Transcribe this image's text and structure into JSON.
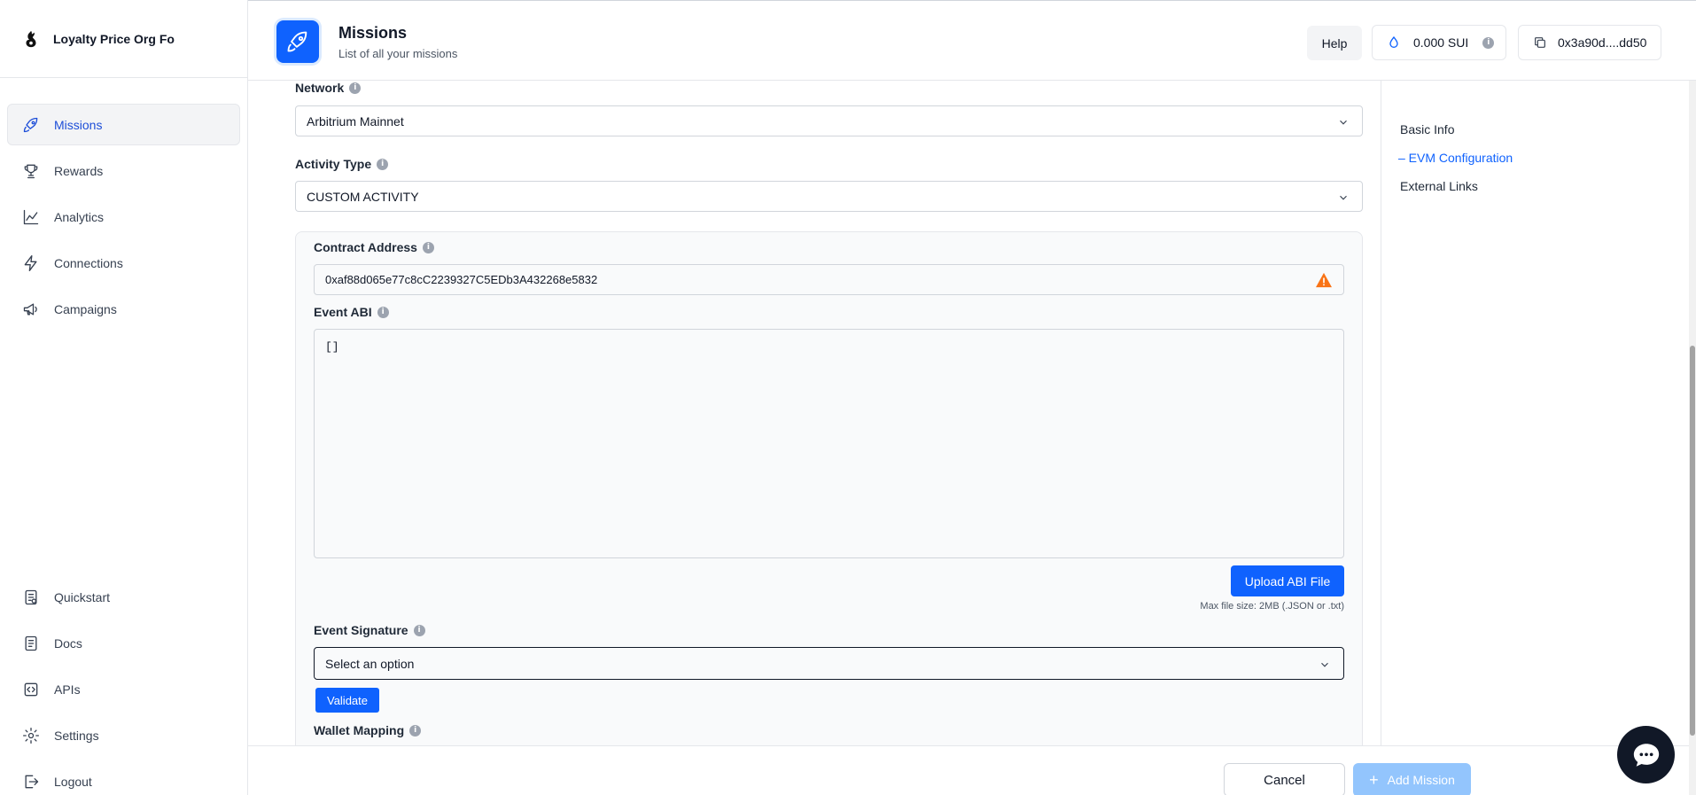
{
  "brand": {
    "name": "Loyalty Price Org Fo"
  },
  "nav": {
    "top": [
      {
        "label": "Missions",
        "icon": "rocket-icon",
        "active": true
      },
      {
        "label": "Rewards",
        "icon": "trophy-icon"
      },
      {
        "label": "Analytics",
        "icon": "chart-line-icon"
      },
      {
        "label": "Connections",
        "icon": "bolt-icon"
      },
      {
        "label": "Campaigns",
        "icon": "megaphone-icon"
      }
    ],
    "bottom": [
      {
        "label": "Quickstart",
        "icon": "quickstart-icon"
      },
      {
        "label": "Docs",
        "icon": "docs-icon"
      },
      {
        "label": "APIs",
        "icon": "code-icon"
      },
      {
        "label": "Settings",
        "icon": "gear-icon"
      },
      {
        "label": "Logout",
        "icon": "logout-icon"
      }
    ]
  },
  "header": {
    "title": "Missions",
    "subtitle": "List of all your missions",
    "help_label": "Help",
    "balance": "0.000 SUI",
    "wallet": "0x3a90d....dd50"
  },
  "form": {
    "network_label": "Network",
    "network_value": "Arbitrium Mainnet",
    "activity_label": "Activity Type",
    "activity_value": "CUSTOM ACTIVITY",
    "contract_label": "Contract Address",
    "contract_value": "0xaf88d065e77c8cC2239327C5EDb3A432268e5832",
    "abi_label": "Event ABI",
    "abi_value": "[]",
    "upload_label": "Upload ABI File",
    "upload_hint": "Max file size: 2MB (.JSON or .txt)",
    "signature_label": "Event Signature",
    "signature_placeholder": "Select an option",
    "validate_label": "Validate",
    "wallet_mapping_label": "Wallet Mapping"
  },
  "toc": {
    "items": [
      "Basic Info",
      "– EVM Configuration",
      "External Links"
    ],
    "active_index": 1
  },
  "footer": {
    "cancel_label": "Cancel",
    "add_label": "Add Mission",
    "add_icon": "plus-icon"
  },
  "colors": {
    "accent": "#0f62fe",
    "active_nav_text": "#1d4ed8",
    "disabled_button": "#93c5fd",
    "warning": "#f97316"
  }
}
